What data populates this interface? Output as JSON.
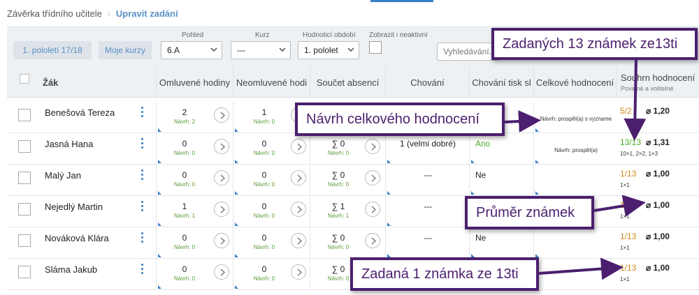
{
  "breadcrumb": {
    "parent": "Závěrka třídního učitele",
    "current": "Upravit zadání"
  },
  "toolbar": {
    "period_button": "1. pololetí 17/18",
    "my_courses_button": "Moje kurzy",
    "view_label": "Pohled",
    "view_value": "6.A",
    "course_label": "Kurz",
    "course_value": "---",
    "grading_label": "Hodnoticí období",
    "grading_value": "1. pololet",
    "inactive_label": "Zobrazit i neaktivní",
    "search_placeholder": "Vyhledávání..."
  },
  "columns": {
    "student": "Žák",
    "excused": "Omluvené hodiny",
    "unexcused": "Neomluvené hodi",
    "absence_sum": "Součet absencí",
    "behavior": "Chování",
    "behavior_print": "Chování tisk sl",
    "overall": "Celkové hodnocení",
    "grades_sum": "Souhrn hodnocení",
    "grades_sub": "Povinné a volitelné"
  },
  "rows": [
    {
      "name": "Benešová Tereza",
      "excused": "2",
      "excused_sub": "Návrh: 2",
      "unexcused": "1",
      "unexcused_sub": "Návrh: 0",
      "absence": "",
      "absence_sub": "",
      "behavior": "",
      "behavior_print": "",
      "overall": "Návrh: prospěl(a) s vyzname",
      "grade": "5/2",
      "grade_sub": "",
      "avg": "⌀ 1,20"
    },
    {
      "name": "Jasná Hana",
      "excused": "0",
      "excused_sub": "Návrh: 0",
      "unexcused": "0",
      "unexcused_sub": "Návrh: 0",
      "absence": "∑ 0",
      "absence_sub": "Návrh: 0",
      "behavior": "1 (velmi dobré)",
      "behavior_print": "Ano",
      "overall": "Návrh: prospěl(a)",
      "grade": "13/13",
      "grade_sub": "10×1, 2×2, 1×3",
      "avg": "⌀ 1,31"
    },
    {
      "name": "Malý Jan",
      "excused": "0",
      "excused_sub": "Návrh: 0",
      "unexcused": "0",
      "unexcused_sub": "Návrh: 0",
      "absence": "∑ 0",
      "absence_sub": "Návrh: 0",
      "behavior": "---",
      "behavior_print": "Ne",
      "overall": "",
      "grade": "1/13",
      "grade_sub": "1×1",
      "avg": "⌀ 1,00"
    },
    {
      "name": "Nejedlý Martin",
      "excused": "1",
      "excused_sub": "Návrh: 1",
      "unexcused": "0",
      "unexcused_sub": "Návrh: 0",
      "absence": "∑ 1",
      "absence_sub": "Návrh: 1",
      "behavior": "---",
      "behavior_print": "",
      "overall": "",
      "grade": "1/",
      "grade_sub": "1×1",
      "avg": "⌀ 1,00"
    },
    {
      "name": "Nováková Klára",
      "excused": "0",
      "excused_sub": "Návrh: 0",
      "unexcused": "0",
      "unexcused_sub": "Návrh: 0",
      "absence": "∑ 0",
      "absence_sub": "Návrh: 0",
      "behavior": "---",
      "behavior_print": "Ne",
      "overall": "",
      "grade": "1/13",
      "grade_sub": "1×1",
      "avg": "⌀ 1,00"
    },
    {
      "name": "Sláma Jakub",
      "excused": "0",
      "excused_sub": "Návrh: 0",
      "unexcused": "0",
      "unexcused_sub": "Návrh: 0",
      "absence": "∑ 0",
      "absence_sub": "Návrh: 0",
      "behavior": "",
      "behavior_print": "",
      "overall": "",
      "grade": "1/13",
      "grade_sub": "1×1",
      "avg": "⌀ 1,00"
    }
  ],
  "callouts": {
    "grades_entered": "Zadaných 13 známek ze13ti",
    "overall_proposal": "Návrh celkového hodnocení",
    "average": "Průměr známek",
    "one_grade": "Zadaná 1 známka ze 13ti"
  },
  "colors": {
    "callout_border": "#4b1f6e",
    "accent": "#3a7fc5",
    "grade_orange": "#d48a1a",
    "green": "#4caa2a"
  }
}
